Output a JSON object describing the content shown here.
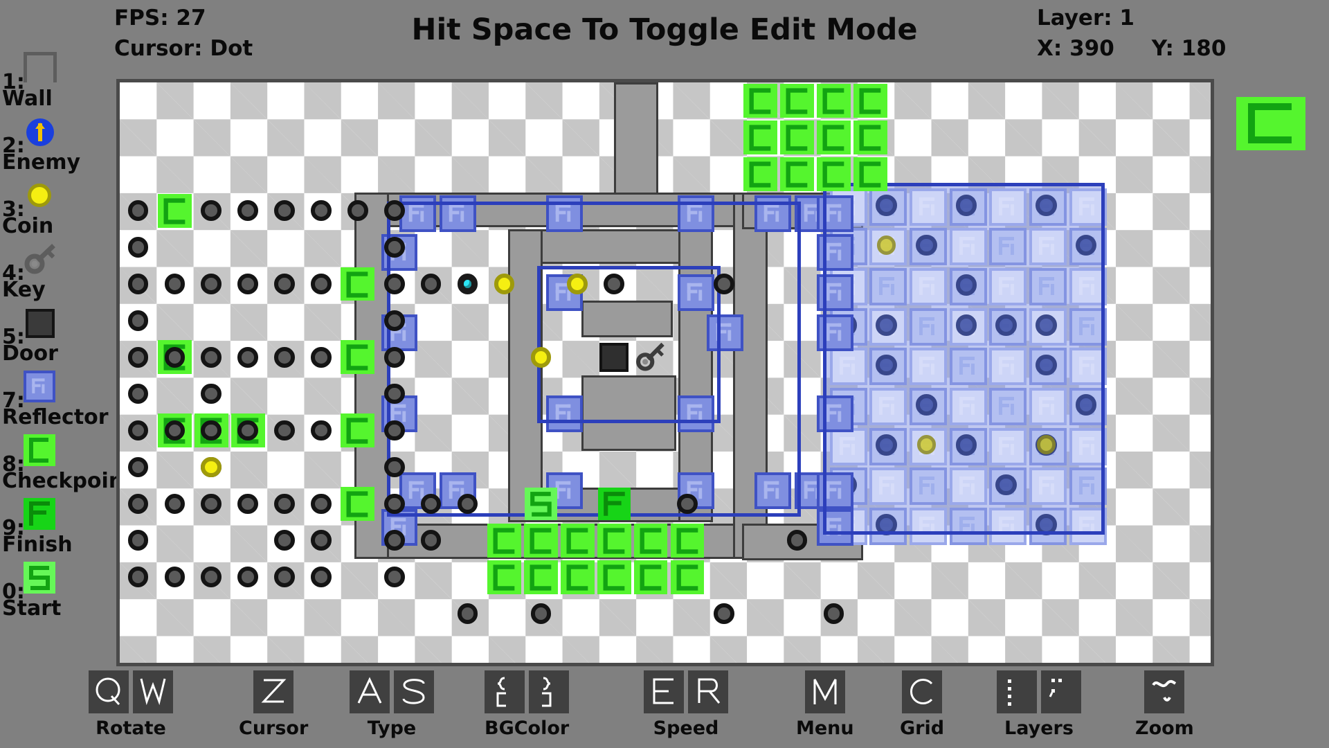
{
  "hud": {
    "fps": "FPS: 27",
    "cursor": "Cursor: Dot",
    "title": "Hit Space To Toggle Edit Mode",
    "layer": "Layer: 1",
    "coords": "X: 390     Y: 180"
  },
  "palette": [
    {
      "num": "1:",
      "label": "Wall",
      "icon": "wall-icon"
    },
    {
      "num": "2:",
      "label": "Enemy",
      "icon": "enemy-icon"
    },
    {
      "num": "3:",
      "label": "Coin",
      "icon": "coin-icon"
    },
    {
      "num": "4:",
      "label": "Key",
      "icon": "key-icon"
    },
    {
      "num": "5:",
      "label": "Door",
      "icon": "door-icon"
    },
    {
      "num": "7:",
      "label": "Reflector",
      "icon": "reflector-icon"
    },
    {
      "num": "8:",
      "label": "Checkpoint",
      "icon": "checkpoint-icon"
    },
    {
      "num": "9:",
      "label": "Finish",
      "icon": "finish-icon"
    },
    {
      "num": "0:",
      "label": "Start",
      "icon": "start-icon"
    }
  ],
  "toolbar": [
    {
      "label": "Rotate",
      "keys": [
        "Q",
        "W"
      ]
    },
    {
      "label": "Cursor",
      "keys": [
        "Z"
      ]
    },
    {
      "label": "Type",
      "keys": [
        "A",
        "S"
      ]
    },
    {
      "label": "BGColor",
      "keys": [
        "{[",
        "}]"
      ]
    },
    {
      "label": "Speed",
      "keys": [
        "E",
        "R"
      ]
    },
    {
      "label": "Menu",
      "keys": [
        "M"
      ]
    },
    {
      "label": "Grid",
      "keys": [
        "C"
      ]
    },
    {
      "label": "Layers",
      "keys": [
        ":",
        "\""
      ]
    },
    {
      "label": "Zoom",
      "keys": [
        "~"
      ]
    }
  ],
  "colors": {
    "background": "#808080",
    "board_light": "#ffffff",
    "board_dark": "#c6c6c6",
    "wall": "#7d7d7d",
    "wall_outline": "#3d3d3d",
    "reflector_fill": "#7f8fe0",
    "reflector_border": "#3f52c4",
    "checkpoint": "#55f52e",
    "finish": "#17d417",
    "start": "#66f758",
    "coin": "#f5ef12",
    "coin_border": "#9e9a0b",
    "enemy": "#1a3fdd",
    "dot": "#5a5a5a",
    "player": "#2ce6f5",
    "door": "#2f2f2f",
    "text": "#0a0a0a",
    "key_top_color": "#55f52e"
  },
  "preview": {
    "label": "checkpoint-preview",
    "color": "#55f52e"
  },
  "board": {
    "cols": 30,
    "rows": 16,
    "cell": 52.9,
    "checkpoints": [
      [
        17,
        0
      ],
      [
        18,
        0
      ],
      [
        19,
        0
      ],
      [
        20,
        0
      ],
      [
        17,
        1
      ],
      [
        18,
        1
      ],
      [
        19,
        1
      ],
      [
        20,
        1
      ],
      [
        17,
        2
      ],
      [
        18,
        2
      ],
      [
        19,
        2
      ],
      [
        20,
        2
      ],
      [
        1,
        3
      ],
      [
        6,
        5
      ],
      [
        1,
        7
      ],
      [
        6,
        7
      ],
      [
        1,
        9
      ],
      [
        2,
        9
      ],
      [
        3,
        9
      ],
      [
        6,
        9
      ],
      [
        6,
        11
      ],
      [
        10,
        12
      ],
      [
        11,
        12
      ],
      [
        12,
        12
      ],
      [
        13,
        12
      ],
      [
        14,
        12
      ],
      [
        15,
        12
      ],
      [
        10,
        13
      ],
      [
        11,
        13
      ],
      [
        12,
        13
      ],
      [
        13,
        13
      ],
      [
        14,
        13
      ],
      [
        15,
        13
      ]
    ],
    "dots": [
      [
        0,
        3
      ],
      [
        2,
        3
      ],
      [
        3,
        3
      ],
      [
        4,
        3
      ],
      [
        5,
        3
      ],
      [
        6,
        3
      ],
      [
        7,
        3
      ],
      [
        0,
        4
      ],
      [
        7,
        4
      ],
      [
        0,
        5
      ],
      [
        1,
        5
      ],
      [
        2,
        5
      ],
      [
        3,
        5
      ],
      [
        4,
        5
      ],
      [
        5,
        5
      ],
      [
        7,
        5
      ],
      [
        0,
        6
      ],
      [
        7,
        6
      ],
      [
        0,
        7
      ],
      [
        1,
        7
      ],
      [
        2,
        7
      ],
      [
        3,
        7
      ],
      [
        4,
        7
      ],
      [
        5,
        7
      ],
      [
        7,
        7
      ],
      [
        0,
        8
      ],
      [
        2,
        8
      ],
      [
        7,
        8
      ],
      [
        0,
        9
      ],
      [
        1,
        9
      ],
      [
        2,
        9
      ],
      [
        3,
        9
      ],
      [
        4,
        9
      ],
      [
        5,
        9
      ],
      [
        7,
        9
      ],
      [
        0,
        10
      ],
      [
        2,
        10
      ],
      [
        7,
        10
      ],
      [
        0,
        11
      ],
      [
        1,
        11
      ],
      [
        2,
        11
      ],
      [
        3,
        11
      ],
      [
        4,
        11
      ],
      [
        5,
        11
      ],
      [
        7,
        11
      ],
      [
        0,
        12
      ],
      [
        4,
        12
      ],
      [
        5,
        12
      ],
      [
        7,
        12
      ],
      [
        0,
        13
      ],
      [
        1,
        13
      ],
      [
        2,
        13
      ],
      [
        3,
        13
      ],
      [
        4,
        13
      ],
      [
        5,
        13
      ],
      [
        7,
        13
      ]
    ],
    "coins": [
      [
        2,
        10
      ],
      [
        10,
        5
      ],
      [
        12,
        5
      ],
      [
        11,
        7
      ]
    ],
    "player": [
      9,
      5
    ],
    "door": [
      13,
      7
    ],
    "key": [
      14,
      7
    ],
    "finish": [
      13,
      11
    ],
    "start": [
      11,
      11
    ]
  },
  "chart_data": null
}
